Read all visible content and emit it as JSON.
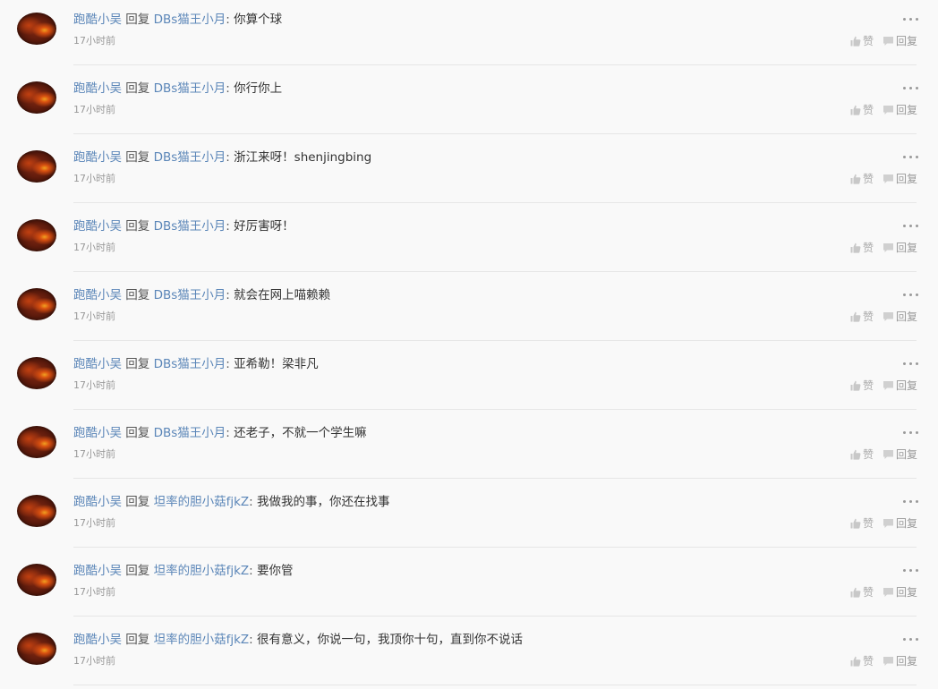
{
  "comments": [
    {
      "author": "跑酷小吴",
      "reply_word": "回复",
      "target": "DBs猫王小月",
      "colon": ":",
      "content": "你算个球",
      "time": "17小时前",
      "like_label": "赞",
      "reply_label": "回复"
    },
    {
      "author": "跑酷小吴",
      "reply_word": "回复",
      "target": "DBs猫王小月",
      "colon": ":",
      "content": "你行你上",
      "time": "17小时前",
      "like_label": "赞",
      "reply_label": "回复"
    },
    {
      "author": "跑酷小吴",
      "reply_word": "回复",
      "target": "DBs猫王小月",
      "colon": ":",
      "content": "浙江来呀！shenjingbing",
      "time": "17小时前",
      "like_label": "赞",
      "reply_label": "回复"
    },
    {
      "author": "跑酷小吴",
      "reply_word": "回复",
      "target": "DBs猫王小月",
      "colon": ":",
      "content": "好厉害呀！",
      "time": "17小时前",
      "like_label": "赞",
      "reply_label": "回复"
    },
    {
      "author": "跑酷小吴",
      "reply_word": "回复",
      "target": "DBs猫王小月",
      "colon": ":",
      "content": "就会在网上喵赖赖",
      "time": "17小时前",
      "like_label": "赞",
      "reply_label": "回复"
    },
    {
      "author": "跑酷小吴",
      "reply_word": "回复",
      "target": "DBs猫王小月",
      "colon": ":",
      "content": "亚希勒！梁非凡",
      "time": "17小时前",
      "like_label": "赞",
      "reply_label": "回复"
    },
    {
      "author": "跑酷小吴",
      "reply_word": "回复",
      "target": "DBs猫王小月",
      "colon": ":",
      "content": "还老子，不就一个学生嘛",
      "time": "17小时前",
      "like_label": "赞",
      "reply_label": "回复"
    },
    {
      "author": "跑酷小吴",
      "reply_word": "回复",
      "target": "坦率的胆小菇fjkZ",
      "colon": ":",
      "content": "我做我的事，你还在找事",
      "time": "17小时前",
      "like_label": "赞",
      "reply_label": "回复"
    },
    {
      "author": "跑酷小吴",
      "reply_word": "回复",
      "target": "坦率的胆小菇fjkZ",
      "colon": ":",
      "content": "要你管",
      "time": "17小时前",
      "like_label": "赞",
      "reply_label": "回复"
    },
    {
      "author": "跑酷小吴",
      "reply_word": "回复",
      "target": "坦率的胆小菇fjkZ",
      "colon": ":",
      "content": "很有意义，你说一句，我顶你十句，直到你不说话",
      "time": "17小时前",
      "like_label": "赞",
      "reply_label": "回复"
    }
  ],
  "icons": {
    "more": "more-dots-icon",
    "like": "thumbs-up-icon",
    "reply": "speech-bubble-icon"
  },
  "colors": {
    "link": "#5b86b8",
    "text": "#333333",
    "muted": "#999999",
    "background": "#f9f9f9",
    "divider": "#e6e6e6"
  }
}
